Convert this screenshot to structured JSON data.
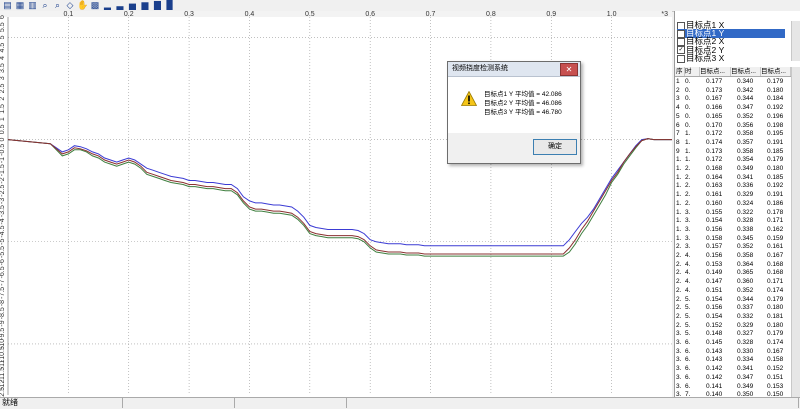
{
  "toolbar": {
    "buttons": [
      "open-icon",
      "save-icon",
      "print-icon",
      "zoom-in-icon",
      "zoom-out-icon",
      "pointer-icon",
      "pan-icon",
      "grid-icon",
      "chart-type-1-icon",
      "chart-type-2-icon",
      "chart-type-3-icon",
      "chart-type-4-icon",
      "chart-type-5-icon",
      "chart-type-6-icon"
    ]
  },
  "series_list": {
    "items": [
      {
        "label": "目标点1 X",
        "checked": false,
        "selected": false
      },
      {
        "label": "目标点1 Y",
        "checked": true,
        "selected": true
      },
      {
        "label": "目标点2 X",
        "checked": false,
        "selected": false
      },
      {
        "label": "目标点2 Y",
        "checked": true,
        "selected": false
      },
      {
        "label": "目标点3 X",
        "checked": false,
        "selected": false
      }
    ]
  },
  "table": {
    "headers": [
      "序",
      "时",
      "目标点...",
      "目标点...",
      "目标点..."
    ],
    "rows": [
      [
        "1",
        "0.",
        "0.177",
        "0.340",
        "0.179"
      ],
      [
        "2",
        "0.",
        "0.173",
        "0.342",
        "0.180"
      ],
      [
        "3",
        "0.",
        "0.167",
        "0.344",
        "0.184"
      ],
      [
        "4",
        "0.",
        "0.166",
        "0.347",
        "0.192"
      ],
      [
        "5",
        "0.",
        "0.165",
        "0.352",
        "0.196"
      ],
      [
        "6",
        "0.",
        "0.170",
        "0.356",
        "0.198"
      ],
      [
        "7",
        "1.",
        "0.172",
        "0.358",
        "0.195"
      ],
      [
        "8",
        "1.",
        "0.174",
        "0.357",
        "0.191"
      ],
      [
        "9",
        "1.",
        "0.173",
        "0.358",
        "0.185"
      ],
      [
        "1.",
        "1.",
        "0.172",
        "0.354",
        "0.179"
      ],
      [
        "1.",
        "2.",
        "0.168",
        "0.349",
        "0.180"
      ],
      [
        "1.",
        "2.",
        "0.164",
        "0.341",
        "0.185"
      ],
      [
        "1.",
        "2.",
        "0.163",
        "0.336",
        "0.192"
      ],
      [
        "1.",
        "2.",
        "0.161",
        "0.329",
        "0.191"
      ],
      [
        "1.",
        "2.",
        "0.160",
        "0.324",
        "0.186"
      ],
      [
        "1.",
        "3.",
        "0.155",
        "0.322",
        "0.178"
      ],
      [
        "1.",
        "3.",
        "0.154",
        "0.328",
        "0.171"
      ],
      [
        "1.",
        "3.",
        "0.156",
        "0.338",
        "0.162"
      ],
      [
        "1.",
        "3.",
        "0.158",
        "0.345",
        "0.159"
      ],
      [
        "2.",
        "3.",
        "0.157",
        "0.352",
        "0.161"
      ],
      [
        "2.",
        "4.",
        "0.156",
        "0.358",
        "0.167"
      ],
      [
        "2.",
        "4.",
        "0.153",
        "0.364",
        "0.168"
      ],
      [
        "2.",
        "4.",
        "0.149",
        "0.365",
        "0.168"
      ],
      [
        "2.",
        "4.",
        "0.147",
        "0.360",
        "0.171"
      ],
      [
        "2.",
        "4.",
        "0.151",
        "0.352",
        "0.174"
      ],
      [
        "2.",
        "5.",
        "0.154",
        "0.344",
        "0.179"
      ],
      [
        "2.",
        "5.",
        "0.156",
        "0.337",
        "0.180"
      ],
      [
        "2.",
        "5.",
        "0.154",
        "0.332",
        "0.181"
      ],
      [
        "2.",
        "5.",
        "0.152",
        "0.329",
        "0.180"
      ],
      [
        "3.",
        "5.",
        "0.148",
        "0.327",
        "0.179"
      ],
      [
        "3.",
        "6.",
        "0.145",
        "0.328",
        "0.174"
      ],
      [
        "3.",
        "6.",
        "0.143",
        "0.330",
        "0.167"
      ],
      [
        "3.",
        "6.",
        "0.143",
        "0.334",
        "0.158"
      ],
      [
        "3.",
        "6.",
        "0.142",
        "0.341",
        "0.152"
      ],
      [
        "3.",
        "6.",
        "0.142",
        "0.347",
        "0.151"
      ],
      [
        "3.",
        "6.",
        "0.141",
        "0.349",
        "0.153"
      ],
      [
        "3.",
        "7.",
        "0.140",
        "0.350",
        "0.150"
      ]
    ]
  },
  "dialog": {
    "title": "视频挠度检测系统",
    "close_label": "✕",
    "lines": [
      "目标点1 Y  平均值 = 42.086",
      "目标点2 Y  平均值 = 46.086",
      "目标点3 Y  平均值 = 46.780"
    ],
    "ok_label": "确定",
    "icon": "warning-icon"
  },
  "statusbar": {
    "text": "就绪"
  },
  "chart_data": {
    "type": "line",
    "x_ticks": [
      "0.1",
      "0.2",
      "0.3",
      "0.4",
      "0.5",
      "0.6",
      "0.7",
      "0.8",
      "0.9",
      "1.0"
    ],
    "x_end_label": "*3",
    "y_ticks": [
      "6",
      "5.5",
      "5",
      "4.5",
      "4",
      "3.5",
      "3",
      "2.5",
      "2",
      "1.5",
      "1",
      "0.5",
      "0",
      "-0.5",
      "-1",
      "-1.5",
      "-2",
      "-2.5",
      "-3",
      "-3.5",
      "-4",
      "-4.5",
      "-5",
      "-5.5",
      "-6",
      "-6.5",
      "-7",
      "-7.5",
      "-8",
      "-8.5",
      "-9",
      "-9.5",
      "-10",
      "-10.5",
      "-11",
      "-11.5",
      "-12",
      "-12.5"
    ],
    "xlim": [
      0,
      1.1
    ],
    "ylim": [
      -12.5,
      6
    ],
    "grid": true,
    "series": [
      {
        "color": "#3b3bd4",
        "x": [
          0,
          0.07,
          0.08,
          0.09,
          0.1,
          0.11,
          0.12,
          0.13,
          0.14,
          0.15,
          0.16,
          0.17,
          0.18,
          0.19,
          0.2,
          0.21,
          0.22,
          0.23,
          0.24,
          0.25,
          0.26,
          0.27,
          0.28,
          0.29,
          0.3,
          0.31,
          0.32,
          0.33,
          0.34,
          0.35,
          0.36,
          0.37,
          0.38,
          0.39,
          0.4,
          0.41,
          0.42,
          0.43,
          0.44,
          0.45,
          0.46,
          0.47,
          0.48,
          0.49,
          0.5,
          0.51,
          0.52,
          0.53,
          0.54,
          0.55,
          0.56,
          0.57,
          0.58,
          0.59,
          0.6,
          0.61,
          0.62,
          0.63,
          0.64,
          0.65,
          0.66,
          0.67,
          0.68,
          0.69,
          0.7,
          0.71,
          0.72,
          0.73,
          0.74,
          0.75,
          0.76,
          0.77,
          0.78,
          0.79,
          0.8,
          0.81,
          0.82,
          0.83,
          0.84,
          0.85,
          0.86,
          0.87,
          0.88,
          0.89,
          0.9,
          0.91,
          0.92,
          0.93,
          0.94,
          0.95,
          0.96,
          0.97,
          0.98,
          0.99,
          1.0,
          1.01,
          1.02,
          1.03,
          1.04,
          1.05,
          1.06,
          1.07,
          1.1
        ],
        "y": [
          0,
          -0.2,
          -0.4,
          -0.6,
          -0.5,
          -0.3,
          -0.35,
          -0.45,
          -0.6,
          -0.7,
          -0.9,
          -1.0,
          -1.1,
          -1.0,
          -0.9,
          -1.0,
          -1.2,
          -1.4,
          -1.5,
          -1.6,
          -1.7,
          -1.8,
          -1.85,
          -1.9,
          -2.0,
          -2.0,
          -2.05,
          -2.1,
          -2.1,
          -2.15,
          -2.2,
          -2.2,
          -2.4,
          -2.8,
          -3.0,
          -3.1,
          -3.1,
          -3.15,
          -3.2,
          -3.2,
          -3.25,
          -3.3,
          -3.5,
          -3.8,
          -4.2,
          -4.3,
          -4.35,
          -4.4,
          -4.4,
          -4.4,
          -4.4,
          -4.4,
          -4.45,
          -4.6,
          -4.9,
          -5.0,
          -5.05,
          -5.1,
          -5.1,
          -5.1,
          -5.15,
          -5.15,
          -5.15,
          -5.2,
          -5.2,
          -5.2,
          -5.2,
          -5.2,
          -5.2,
          -5.2,
          -5.2,
          -5.2,
          -5.2,
          -5.2,
          -5.2,
          -5.2,
          -5.2,
          -5.2,
          -5.2,
          -5.2,
          -5.2,
          -5.2,
          -5.2,
          -5.2,
          -5.2,
          -5.2,
          -5.2,
          -4.9,
          -4.5,
          -4.1,
          -3.8,
          -3.4,
          -2.9,
          -2.4,
          -1.9,
          -1.5,
          -1.1,
          -0.7,
          -0.3,
          0,
          0.05,
          0,
          0
        ]
      },
      {
        "color": "#3f7f3f",
        "x": [
          0,
          0.07,
          0.08,
          0.09,
          0.1,
          0.11,
          0.12,
          0.13,
          0.14,
          0.15,
          0.16,
          0.17,
          0.18,
          0.19,
          0.2,
          0.21,
          0.22,
          0.23,
          0.24,
          0.25,
          0.26,
          0.27,
          0.28,
          0.29,
          0.3,
          0.31,
          0.32,
          0.33,
          0.34,
          0.35,
          0.36,
          0.37,
          0.38,
          0.39,
          0.4,
          0.41,
          0.42,
          0.43,
          0.44,
          0.45,
          0.46,
          0.47,
          0.48,
          0.49,
          0.5,
          0.51,
          0.52,
          0.53,
          0.54,
          0.55,
          0.56,
          0.57,
          0.58,
          0.59,
          0.6,
          0.61,
          0.62,
          0.63,
          0.64,
          0.65,
          0.66,
          0.67,
          0.68,
          0.69,
          0.7,
          0.71,
          0.72,
          0.73,
          0.74,
          0.75,
          0.76,
          0.77,
          0.78,
          0.79,
          0.8,
          0.81,
          0.82,
          0.83,
          0.84,
          0.85,
          0.86,
          0.87,
          0.88,
          0.89,
          0.9,
          0.91,
          0.92,
          0.93,
          0.94,
          0.95,
          0.96,
          0.97,
          0.98,
          0.99,
          1.0,
          1.01,
          1.02,
          1.03,
          1.04,
          1.05,
          1.06,
          1.07,
          1.1
        ],
        "y": [
          0,
          -0.2,
          -0.5,
          -0.8,
          -0.7,
          -0.5,
          -0.5,
          -0.6,
          -0.8,
          -0.9,
          -1.1,
          -1.2,
          -1.3,
          -1.2,
          -1.1,
          -1.2,
          -1.4,
          -1.7,
          -1.8,
          -1.9,
          -2.0,
          -2.1,
          -2.15,
          -2.2,
          -2.3,
          -2.3,
          -2.35,
          -2.4,
          -2.4,
          -2.45,
          -2.5,
          -2.5,
          -2.7,
          -3.1,
          -3.4,
          -3.5,
          -3.5,
          -3.55,
          -3.6,
          -3.6,
          -3.65,
          -3.7,
          -3.9,
          -4.2,
          -4.6,
          -4.7,
          -4.75,
          -4.8,
          -4.8,
          -4.8,
          -4.8,
          -4.8,
          -4.85,
          -5.0,
          -5.3,
          -5.5,
          -5.55,
          -5.6,
          -5.6,
          -5.6,
          -5.65,
          -5.65,
          -5.65,
          -5.7,
          -5.7,
          -5.7,
          -5.7,
          -5.7,
          -5.7,
          -5.7,
          -5.7,
          -5.7,
          -5.7,
          -5.7,
          -5.7,
          -5.7,
          -5.7,
          -5.7,
          -5.7,
          -5.7,
          -5.7,
          -5.7,
          -5.7,
          -5.7,
          -5.7,
          -5.7,
          -5.7,
          -5.5,
          -5.1,
          -4.6,
          -4.2,
          -3.7,
          -3.2,
          -2.7,
          -2.1,
          -1.7,
          -1.2,
          -0.8,
          -0.4,
          -0.05,
          0.05,
          0,
          0
        ]
      },
      {
        "color": "#8a3030",
        "x": [
          0,
          0.07,
          0.08,
          0.09,
          0.1,
          0.11,
          0.12,
          0.13,
          0.14,
          0.15,
          0.16,
          0.17,
          0.18,
          0.19,
          0.2,
          0.21,
          0.22,
          0.23,
          0.24,
          0.25,
          0.26,
          0.27,
          0.28,
          0.29,
          0.3,
          0.31,
          0.32,
          0.33,
          0.34,
          0.35,
          0.36,
          0.37,
          0.38,
          0.39,
          0.4,
          0.41,
          0.42,
          0.43,
          0.44,
          0.45,
          0.46,
          0.47,
          0.48,
          0.49,
          0.5,
          0.51,
          0.52,
          0.53,
          0.54,
          0.55,
          0.56,
          0.57,
          0.58,
          0.59,
          0.6,
          0.61,
          0.62,
          0.63,
          0.64,
          0.65,
          0.66,
          0.67,
          0.68,
          0.69,
          0.7,
          0.71,
          0.72,
          0.73,
          0.74,
          0.75,
          0.76,
          0.77,
          0.78,
          0.79,
          0.8,
          0.81,
          0.82,
          0.83,
          0.84,
          0.85,
          0.86,
          0.87,
          0.88,
          0.89,
          0.9,
          0.91,
          0.92,
          0.93,
          0.94,
          0.95,
          0.96,
          0.97,
          0.98,
          0.99,
          1.0,
          1.01,
          1.02,
          1.03,
          1.04,
          1.05,
          1.06,
          1.07,
          1.1
        ],
        "y": [
          0,
          -0.2,
          -0.45,
          -0.7,
          -0.6,
          -0.4,
          -0.45,
          -0.55,
          -0.7,
          -0.8,
          -1.0,
          -1.1,
          -1.2,
          -1.1,
          -1.0,
          -1.1,
          -1.3,
          -1.6,
          -1.7,
          -1.8,
          -1.9,
          -2.0,
          -2.05,
          -2.1,
          -2.2,
          -2.2,
          -2.25,
          -2.3,
          -2.3,
          -2.35,
          -2.4,
          -2.4,
          -2.6,
          -3.0,
          -3.3,
          -3.4,
          -3.4,
          -3.45,
          -3.5,
          -3.5,
          -3.55,
          -3.6,
          -3.8,
          -4.1,
          -4.5,
          -4.6,
          -4.65,
          -4.7,
          -4.7,
          -4.7,
          -4.7,
          -4.7,
          -4.75,
          -4.9,
          -5.2,
          -5.4,
          -5.45,
          -5.5,
          -5.5,
          -5.5,
          -5.55,
          -5.55,
          -5.55,
          -5.6,
          -5.6,
          -5.6,
          -5.6,
          -5.6,
          -5.6,
          -5.6,
          -5.6,
          -5.6,
          -5.6,
          -5.6,
          -5.6,
          -5.6,
          -5.6,
          -5.6,
          -5.6,
          -5.6,
          -5.6,
          -5.6,
          -5.6,
          -5.6,
          -5.6,
          -5.6,
          -5.6,
          -5.3,
          -4.9,
          -4.4,
          -4.0,
          -3.5,
          -3.0,
          -2.5,
          -2.0,
          -1.6,
          -1.1,
          -0.7,
          -0.35,
          -0.05,
          0.05,
          0,
          0
        ]
      }
    ]
  }
}
